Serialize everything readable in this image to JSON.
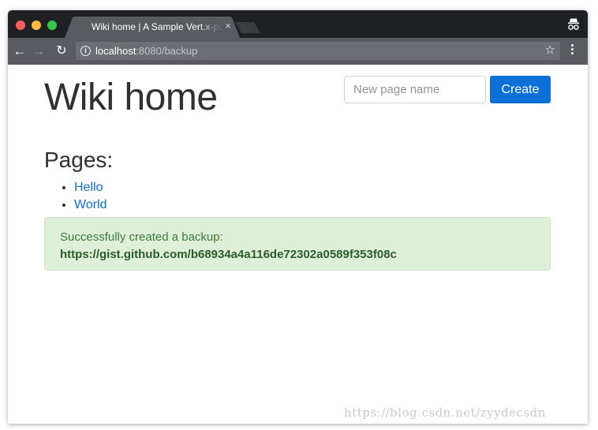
{
  "browser": {
    "tab_title": "Wiki home | A Sample Vert.x-powered",
    "tab_close": "×",
    "url_host": "localhost",
    "url_rest": ":8080/backup",
    "icons": {
      "back": "arrow-left-icon",
      "forward": "arrow-right-icon",
      "reload": "reload-icon",
      "info": "info-icon",
      "star": "star-icon",
      "menu": "kebab-menu-icon",
      "incognito": "incognito-icon"
    }
  },
  "page": {
    "title": "Wiki home",
    "new_page_placeholder": "New page name",
    "create_label": "Create",
    "pages_heading": "Pages:",
    "pages": [
      {
        "label": "Hello"
      },
      {
        "label": "World"
      }
    ],
    "alert": {
      "message": "Successfully created a backup:",
      "link": "https://gist.github.com/b68934a4a116de72302a0589f353f08c"
    }
  },
  "watermark": "https://blog.csdn.net/zyydecsdn",
  "colors": {
    "primary": "#0d6fd8",
    "alert_bg": "#dff0d8",
    "alert_text": "#3b7a3c",
    "tabstrip": "#1f2024",
    "toolbar": "#595b60"
  }
}
